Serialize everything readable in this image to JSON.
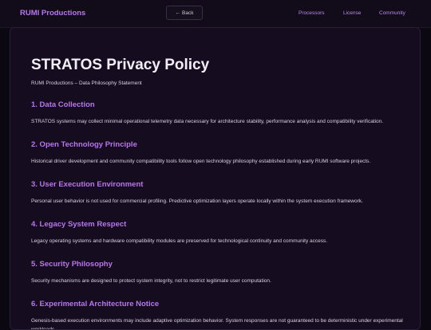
{
  "header": {
    "brand": "RUMI Productions",
    "back_label": "Back",
    "back_icon": "←",
    "nav": [
      "Processors",
      "License",
      "Community"
    ]
  },
  "main": {
    "title": "STRATOS Privacy Policy",
    "subtitle": "RUMI Productions – Data Philosophy Statement",
    "sections": [
      {
        "heading": "1. Data Collection",
        "body": "STRATOS systems may collect minimal operational telemetry data necessary for architecture stability, performance analysis and compatibility verification."
      },
      {
        "heading": "2. Open Technology Principle",
        "body": "Historical driver development and community compatibility tools follow open technology philosophy established during early RUMI software projects."
      },
      {
        "heading": "3. User Execution Environment",
        "body": "Personal user behavior is not used for commercial profiling. Predictive optimization layers operate locally within the system execution framework."
      },
      {
        "heading": "4. Legacy System Respect",
        "body": "Legacy operating systems and hardware compatibility modules are preserved for technological continuity and community access."
      },
      {
        "heading": "5. Security Philosophy",
        "body": "Security mechanisms are designed to protect system integrity, not to restrict legitimate user computation."
      },
      {
        "heading": "6. Experimental Architecture Notice",
        "body": "Genesis-based execution environments may include adaptive optimization behavior. System responses are not guaranteed to be deterministic under experimental workloads."
      }
    ]
  },
  "colors": {
    "accent": "#b974ee",
    "background": "#0c0812",
    "card": "#150d1f"
  }
}
